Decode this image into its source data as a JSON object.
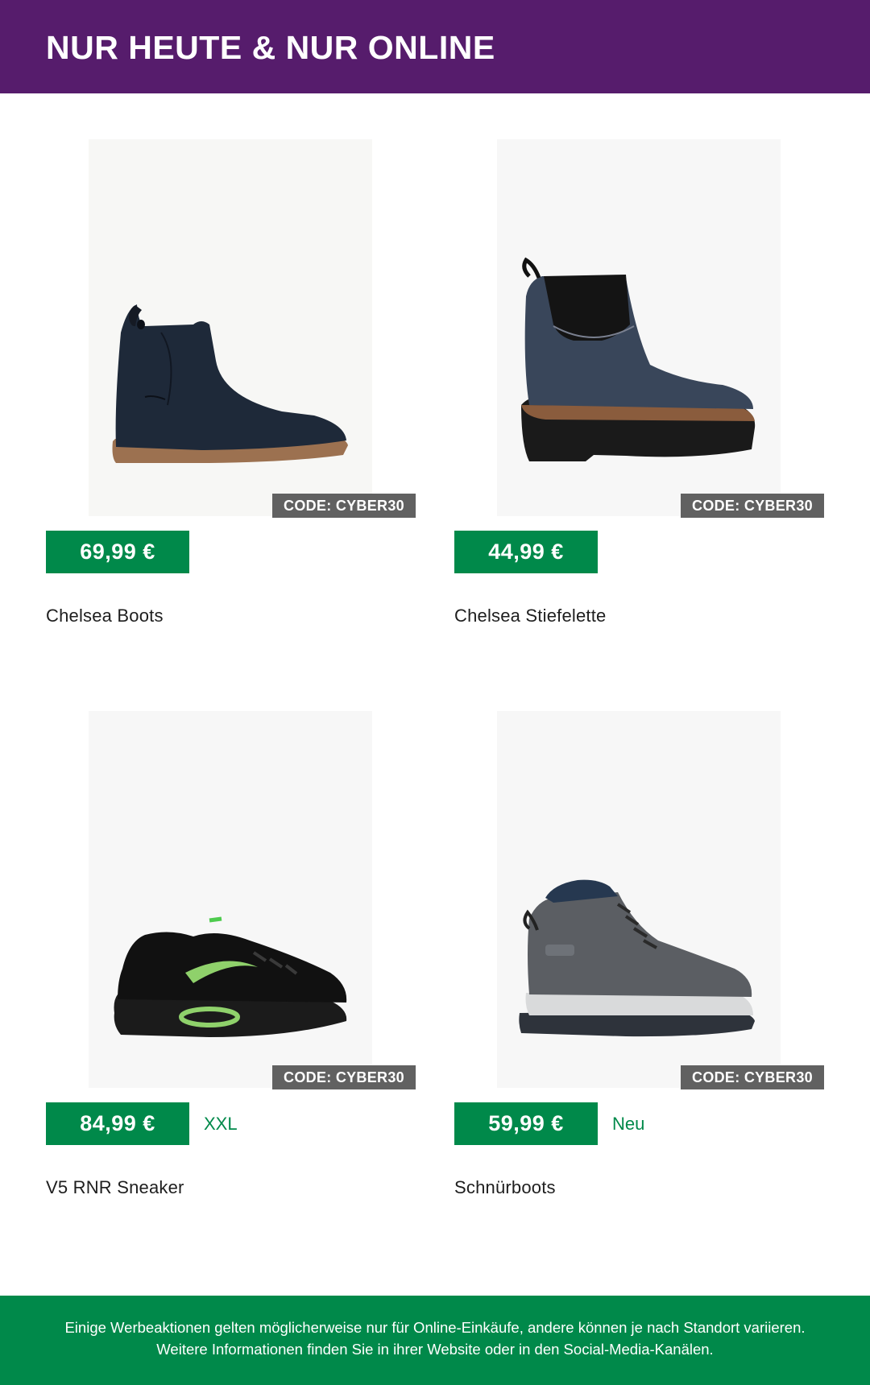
{
  "banner": {
    "title": "NUR HEUTE & NUR ONLINE"
  },
  "products": [
    {
      "name": "Chelsea Boots",
      "price": "69,99 €",
      "code": "CODE: CYBER30",
      "tag": "",
      "image_icon": "chelsea-boot-icon"
    },
    {
      "name": "Chelsea Stiefelette",
      "price": "44,99 €",
      "code": "CODE: CYBER30",
      "tag": "",
      "image_icon": "heeled-chelsea-boot-icon"
    },
    {
      "name": "V5 RNR Sneaker",
      "price": "84,99 €",
      "code": "CODE: CYBER30",
      "tag": "XXL",
      "image_icon": "sneaker-icon"
    },
    {
      "name": "Schnürboots",
      "price": "59,99 €",
      "code": "CODE: CYBER30",
      "tag": "Neu",
      "image_icon": "lace-up-boot-icon"
    }
  ],
  "footer": {
    "disclaimer": "Einige Werbeaktionen gelten möglicherweise nur für Online-Einkäufe, andere können je nach Standort variieren. Weitere Informationen finden Sie in ihrer Website oder in den Social-Media-Kanälen."
  },
  "colors": {
    "banner": "#561c6c",
    "price_badge": "#00894a",
    "code_badge": "#616161",
    "footer": "#00894a"
  }
}
